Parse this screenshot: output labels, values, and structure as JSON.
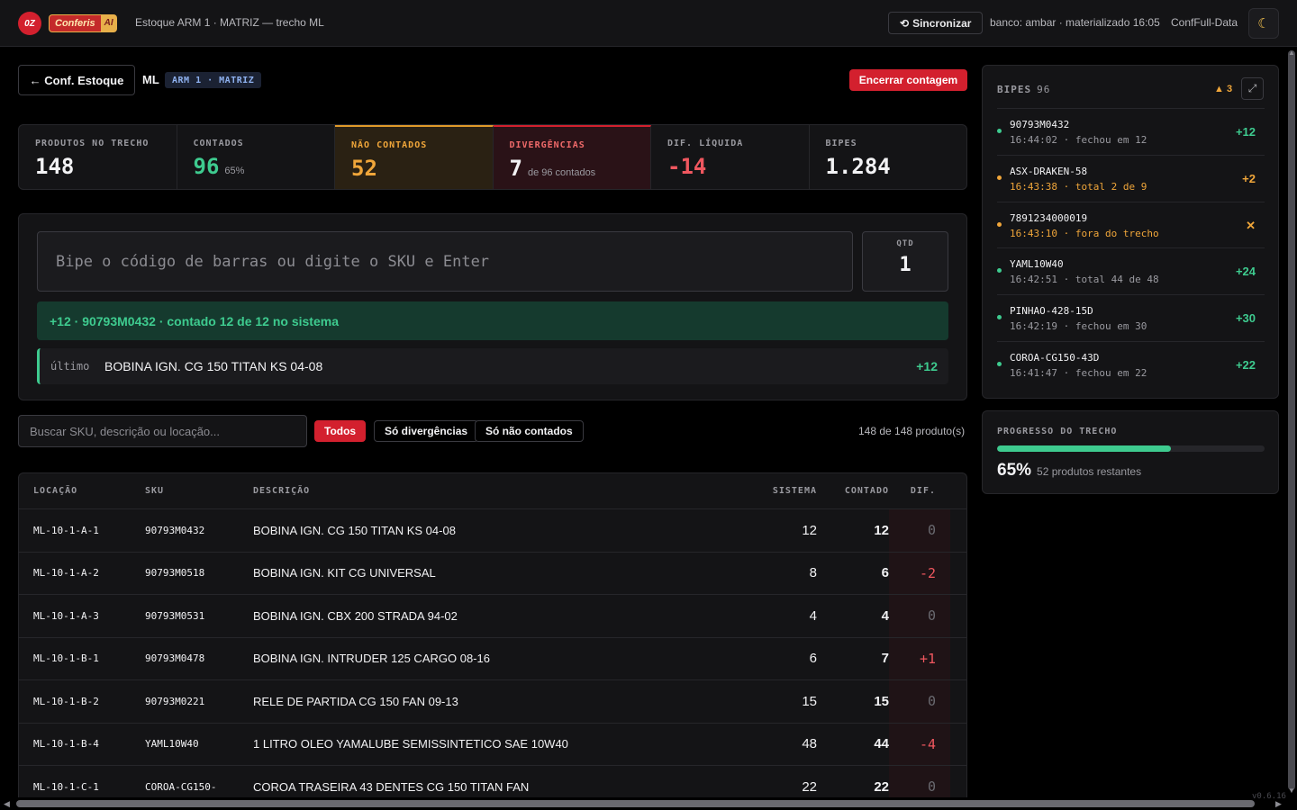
{
  "topbar": {
    "logo_text": "0Z",
    "brand_name": "Conferis",
    "brand_suffix": "AI",
    "breadcrumb": "Estoque ARM 1 · MATRIZ — trecho ML",
    "sync_label": "Sincronizar",
    "db_info": "banco: ambar · materializado 16:05",
    "env": "ConfFull-Data",
    "theme_icon": "moon-icon"
  },
  "header": {
    "back_label": "← Conf. Estoque",
    "section": "ML",
    "arm_badge": "ARM 1 · MATRIZ",
    "end_label": "Encerrar contagem"
  },
  "stats": {
    "produtos": {
      "label": "PRODUTOS NO TRECHO",
      "value": "148"
    },
    "contados": {
      "label": "CONTADOS",
      "value": "96",
      "sub": "65%"
    },
    "nao_contados": {
      "label": "NÃO CONTADOS",
      "value": "52"
    },
    "divergencias": {
      "label": "DIVERGÊNCIAS",
      "value": "7",
      "sub": "de 96 contados"
    },
    "dif_liquida": {
      "label": "DIF. LÍQUIDA",
      "value": "-14"
    },
    "bipes": {
      "label": "BIPES",
      "value": "1.284"
    }
  },
  "scan": {
    "placeholder": "Bipe o código de barras ou digite o SKU e Enter",
    "qty_label": "QTD",
    "qty_value": "1",
    "feedback": "+12 · 90793M0432 · contado 12 de 12 no sistema",
    "last_label": "último",
    "last_desc": "BOBINA IGN. CG 150 TITAN KS 04-08",
    "last_delta": "+12"
  },
  "filters": {
    "search_placeholder": "Buscar SKU, descrição ou locação...",
    "all": "Todos",
    "divergences": "Só divergências",
    "not_counted": "Só não contados",
    "count": "148 de 148 produto(s)"
  },
  "table": {
    "headers": {
      "loc": "LOCAÇÃO",
      "sku": "SKU",
      "desc": "DESCRIÇÃO",
      "sistema": "SISTEMA",
      "contado": "CONTADO",
      "dif": "DIF."
    },
    "rows": [
      {
        "loc": "ML-10-1-A-1",
        "sku": "90793M0432",
        "desc": "BOBINA IGN. CG 150 TITAN KS 04-08",
        "sistema": "12",
        "contado": "12",
        "dif": "0"
      },
      {
        "loc": "ML-10-1-A-2",
        "sku": "90793M0518",
        "desc": "BOBINA IGN. KIT CG UNIVERSAL",
        "sistema": "8",
        "contado": "6",
        "dif": "-2"
      },
      {
        "loc": "ML-10-1-A-3",
        "sku": "90793M0531",
        "desc": "BOBINA IGN. CBX 200 STRADA 94-02",
        "sistema": "4",
        "contado": "4",
        "dif": "0"
      },
      {
        "loc": "ML-10-1-B-1",
        "sku": "90793M0478",
        "desc": "BOBINA IGN. INTRUDER 125 CARGO 08-16",
        "sistema": "6",
        "contado": "7",
        "dif": "+1"
      },
      {
        "loc": "ML-10-1-B-2",
        "sku": "90793M0221",
        "desc": "RELE DE PARTIDA CG 150 FAN 09-13",
        "sistema": "15",
        "contado": "15",
        "dif": "0"
      },
      {
        "loc": "ML-10-1-B-4",
        "sku": "YAML10W40",
        "desc": "1 LITRO OLEO YAMALUBE SEMISSINTETICO SAE 10W40",
        "sistema": "48",
        "contado": "44",
        "dif": "-4"
      },
      {
        "loc": "ML-10-1-C-1",
        "sku": "COROA-CG150-",
        "desc": "COROA TRASEIRA 43 DENTES CG 150 TITAN FAN",
        "sistema": "22",
        "contado": "22",
        "dif": "0"
      }
    ]
  },
  "bipes": {
    "title": "BIPES",
    "count": "96",
    "warnings": "3",
    "items": [
      {
        "code": "90793M0432",
        "meta": "16:44:02 · fechou em 12",
        "delta": "+12",
        "status": "ok"
      },
      {
        "code": "ASX-DRAKEN-58",
        "meta": "16:43:38 · total 2 de 9",
        "delta": "+2",
        "status": "warn"
      },
      {
        "code": "7891234000019",
        "meta": "16:43:10 · fora do trecho",
        "delta": "✕",
        "status": "warn"
      },
      {
        "code": "YAML10W40",
        "meta": "16:42:51 · total 44 de 48",
        "delta": "+24",
        "status": "ok"
      },
      {
        "code": "PINHAO-428-15D",
        "meta": "16:42:19 · fechou em 30",
        "delta": "+30",
        "status": "ok"
      },
      {
        "code": "COROA-CG150-43D",
        "meta": "16:41:47 · fechou em 22",
        "delta": "+22",
        "status": "ok"
      }
    ]
  },
  "progress": {
    "label": "PROGRESSO DO TRECHO",
    "percent": 0.65,
    "value": "65%",
    "sub": "52 produtos restantes"
  },
  "version": "v0.6.16",
  "colors": {
    "accent": "#d3202e",
    "success": "#3ecb8f",
    "warning": "#f0a63a",
    "danger": "#f0575f"
  }
}
